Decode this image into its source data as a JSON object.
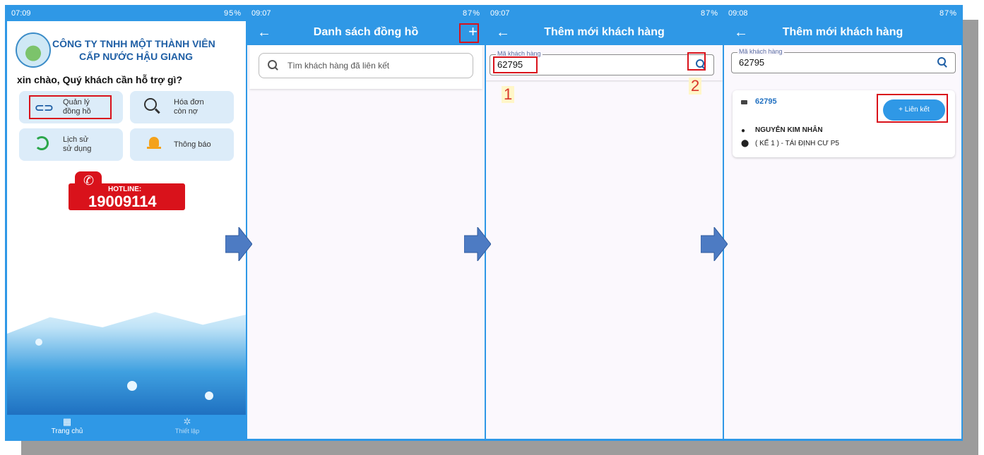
{
  "colors": {
    "primary": "#2f98e6",
    "highlight": "#d9121b",
    "arrow": "#4d7bc3",
    "step_number": "#d9362b"
  },
  "screen1": {
    "status_time": "07:09",
    "status_icons": "95%",
    "company_line1": "CÔNG TY TNHH MỘT THÀNH VIÊN",
    "company_line2": "CẤP NƯỚC HẬU GIANG",
    "greeting": "xin chào, Quý khách cần hỗ trợ gì?",
    "tiles": [
      {
        "line1": "Quản lý",
        "line2": "đồng hồ",
        "icon": "link-icon"
      },
      {
        "line1": "Hóa đơn",
        "line2": "còn nợ",
        "icon": "search-icon"
      },
      {
        "line1": "Lịch sử",
        "line2": "sử dụng",
        "icon": "history-icon"
      },
      {
        "line1": "Thông báo",
        "line2": "",
        "icon": "bell-icon"
      }
    ],
    "hotline_label": "HOTLINE:",
    "hotline_number": "19009114",
    "nav": [
      {
        "label": "Trang chủ",
        "icon": "grid-icon"
      },
      {
        "label": "Thiết lập",
        "icon": "gear-icon"
      }
    ]
  },
  "screen2": {
    "status_time": "09:07",
    "status_icons": "87%",
    "title": "Danh sách đồng hồ",
    "add_label": "+",
    "search_placeholder": "Tìm khách hàng đã liên kết"
  },
  "screen3": {
    "status_time": "09:07",
    "status_icons": "87%",
    "title": "Thêm mới khách hàng",
    "field_label": "Mã khách hàng",
    "field_value": "62795",
    "step1": "1",
    "step2": "2"
  },
  "screen4": {
    "status_time": "09:08",
    "status_icons": "87%",
    "title": "Thêm mới khách hàng",
    "field_label": "Mã khách hàng",
    "field_value": "62795",
    "result_code": "62795",
    "link_button": "+ Liên kết",
    "customer_name": "NGUYỄN KIM NHÂN",
    "address": "( KẾ 1 ) - TÁI ĐỊNH CƯ P5"
  }
}
